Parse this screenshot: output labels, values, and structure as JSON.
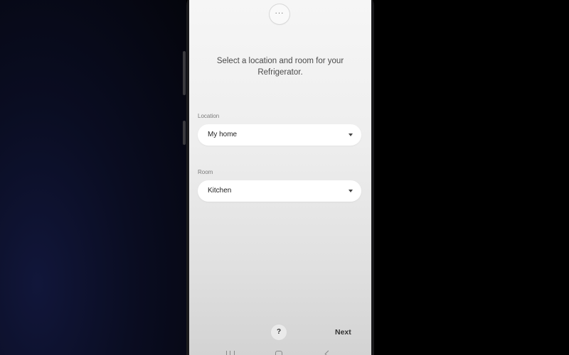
{
  "camera": {
    "glyph": "···"
  },
  "setup": {
    "prompt": "Select a location and room for your Refrigerator."
  },
  "location": {
    "label": "Location",
    "value": "My home"
  },
  "room": {
    "label": "Room",
    "value": "Kitchen"
  },
  "footer": {
    "help_label": "?",
    "next_label": "Next"
  },
  "icons": {
    "camera": "camera-dots-icon",
    "caret": "caret-down-icon",
    "help": "help-icon",
    "recent": "recent-apps-icon",
    "home": "home-icon",
    "back": "back-icon"
  },
  "colors": {
    "screen_bg": "#eeeeee",
    "field_bg": "#ffffff",
    "text": "#4a4a4a",
    "phone_frame": "#1b1b1d"
  }
}
